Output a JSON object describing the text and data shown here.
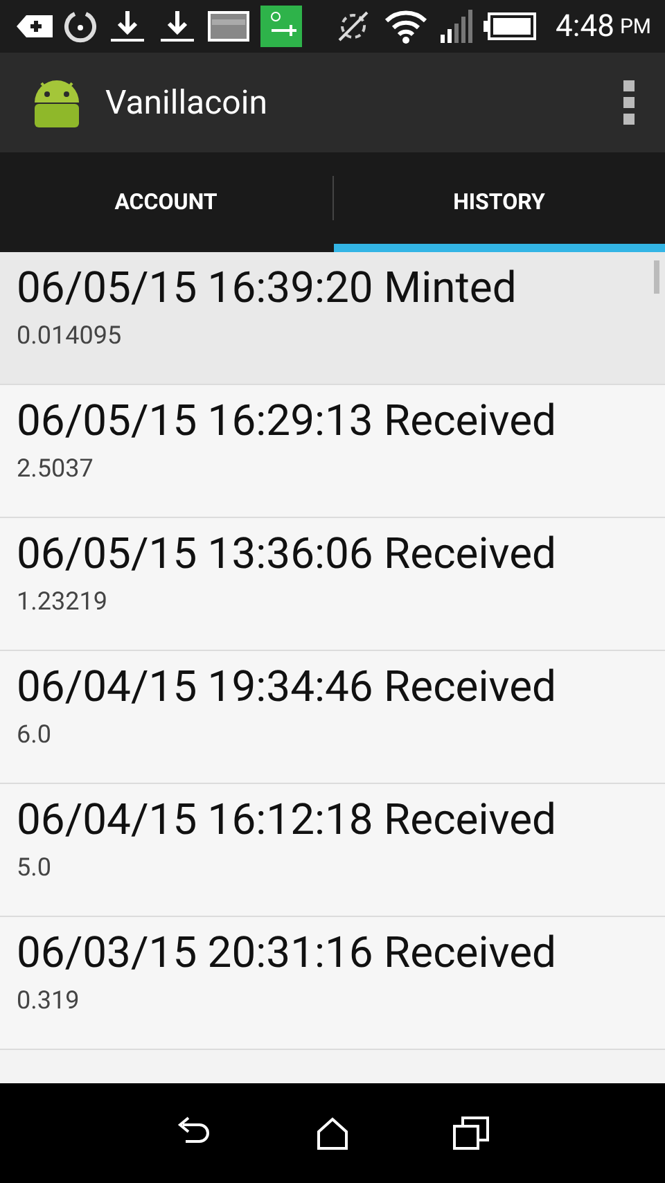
{
  "status_bar": {
    "time": "4:48",
    "ampm": "PM"
  },
  "app_bar": {
    "title": "Vanillacoin"
  },
  "tabs": [
    {
      "label": "ACCOUNT",
      "selected": false
    },
    {
      "label": "HISTORY",
      "selected": true
    }
  ],
  "transactions": [
    {
      "title": "06/05/15 16:39:20 Minted",
      "amount": "0.014095",
      "selected": true
    },
    {
      "title": "06/05/15 16:29:13 Received",
      "amount": "2.5037",
      "selected": false
    },
    {
      "title": "06/05/15 13:36:06 Received",
      "amount": "1.23219",
      "selected": false
    },
    {
      "title": "06/04/15 19:34:46 Received",
      "amount": "6.0",
      "selected": false
    },
    {
      "title": "06/04/15 16:12:18 Received",
      "amount": "5.0",
      "selected": false
    },
    {
      "title": "06/03/15 20:31:16 Received",
      "amount": "0.319",
      "selected": false
    }
  ]
}
